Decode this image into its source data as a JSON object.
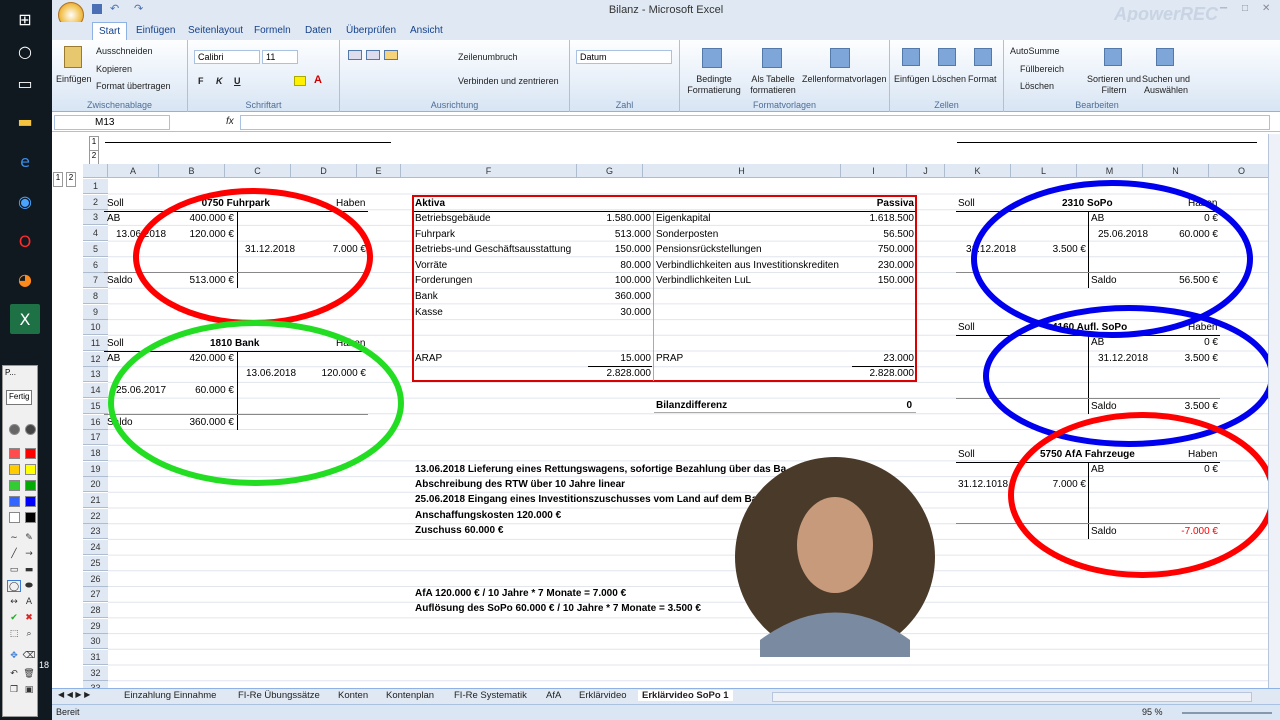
{
  "window": {
    "title": "Bilanz - Microsoft Excel",
    "watermark": "ApowerREC"
  },
  "ribbon": {
    "tabs": [
      "Start",
      "Einfügen",
      "Seitenlayout",
      "Formeln",
      "Daten",
      "Überprüfen",
      "Ansicht"
    ],
    "clipboard": {
      "paste": "Einfügen",
      "cut": "Ausschneiden",
      "copy": "Kopieren",
      "format_painter": "Format übertragen",
      "label": "Zwischenablage"
    },
    "font": {
      "name": "Calibri",
      "size": "11",
      "label": "Schriftart",
      "bold": "F",
      "italic": "K",
      "underline": "U"
    },
    "alignment": {
      "wrap": "Zeilenumbruch",
      "merge": "Verbinden und zentrieren",
      "label": "Ausrichtung"
    },
    "number": {
      "format": "Datum",
      "label": "Zahl"
    },
    "styles": {
      "cond": "Bedingte Formatierung",
      "table": "Als Tabelle formatieren",
      "cell": "Zellenformatvorlagen",
      "label": "Formatvorlagen"
    },
    "cells": {
      "insert": "Einfügen",
      "delete": "Löschen",
      "format": "Format",
      "label": "Zellen"
    },
    "editing": {
      "autosum": "AutoSumme",
      "fill": "Füllbereich",
      "clear": "Löschen",
      "sort": "Sortieren und Filtern",
      "find": "Suchen und Auswählen",
      "label": "Bearbeiten"
    }
  },
  "formula_bar": {
    "name_box": "M13",
    "fx": "fx",
    "value": ""
  },
  "grid": {
    "columns": [
      "A",
      "B",
      "C",
      "D",
      "E",
      "F",
      "G",
      "H",
      "I",
      "J",
      "K",
      "L",
      "M",
      "N",
      "O"
    ],
    "rows": [
      "1",
      "2",
      "3",
      "4",
      "5",
      "6",
      "7",
      "8",
      "9",
      "10",
      "11",
      "12",
      "13",
      "14",
      "15",
      "16",
      "17",
      "18",
      "19",
      "20",
      "21",
      "22",
      "23",
      "24",
      "25",
      "26",
      "27",
      "28",
      "29",
      "30",
      "31",
      "32",
      "33"
    ],
    "outline_levels": [
      "1",
      "2"
    ]
  },
  "fuhrpark": {
    "title": "0750 Fuhrpark",
    "soll": "Soll",
    "haben": "Haben",
    "ab": "AB",
    "ab_val": "400.000 €",
    "d1": "13.06.2018",
    "v1": "120.000 €",
    "d2": "31.12.2018",
    "v2": "7.000 €",
    "saldo": "Saldo",
    "saldo_val": "513.000 €"
  },
  "bank": {
    "title": "1810 Bank",
    "soll": "Soll",
    "haben": "Haben",
    "ab": "AB",
    "ab_val": "420.000 €",
    "d1": "13.06.2018",
    "v1": "120.000 €",
    "d2": "25.06.2017",
    "v2": "60.000 €",
    "saldo": "Saldo",
    "saldo_val": "360.000 €"
  },
  "bilanz": {
    "aktiva": "Aktiva",
    "passiva": "Passiva",
    "left": [
      [
        "Betriebsgebäude",
        "1.580.000"
      ],
      [
        "Fuhrpark",
        "513.000"
      ],
      [
        "Betriebs-und Geschäftsausstattung",
        "150.000"
      ],
      [
        "Vorräte",
        "80.000"
      ],
      [
        "Forderungen",
        "100.000"
      ],
      [
        "Bank",
        "360.000"
      ],
      [
        "Kasse",
        "30.000"
      ]
    ],
    "right": [
      [
        "Eigenkapital",
        "1.618.500"
      ],
      [
        "Sonderposten",
        "56.500"
      ],
      [
        "Pensionsrückstellungen",
        "750.000"
      ],
      [
        "Verbindlichkeiten aus Investitionskrediten",
        "230.000"
      ],
      [
        "Verbindlichkeiten LuL",
        "150.000"
      ]
    ],
    "arap": "ARAP",
    "arap_val": "15.000",
    "prap": "PRAP",
    "prap_val": "23.000",
    "sum_left": "2.828.000",
    "sum_right": "2.828.000",
    "diff_label": "Bilanzdifferenz",
    "diff_val": "0"
  },
  "notes": [
    "13.06.2018 Lieferung eines Rettungswagens, sofortige Bezahlung über das Ba",
    "Abschreibung des RTW über 10 Jahre linear",
    "25.06.2018 Eingang eines Investitionszuschusses vom Land auf dem Ba",
    "Anschaffungskosten 120.000 €",
    "Zuschuss 60.000 €"
  ],
  "calc": [
    "AfA 120.000 € / 10 Jahre * 7 Monate = 7.000 €",
    "Auflösung des SoPo 60.000 € / 10 Jahre * 7 Monate = 3.500 €"
  ],
  "sopo": {
    "title": "2310 SoPo",
    "soll": "Soll",
    "haben": "Haben",
    "ab": "AB",
    "ab_val": "0 €",
    "d1": "25.06.2018",
    "v1": "60.000 €",
    "d2": "31.12.2018",
    "v2": "3.500 €",
    "saldo": "Saldo",
    "saldo_val": "56.500 €"
  },
  "aufl": {
    "title": "4160 Aufl. SoPo",
    "soll": "Soll",
    "haben": "Haben",
    "ab": "AB",
    "ab_val": "0 €",
    "d1": "31.12.2018",
    "v1": "3.500 €",
    "saldo": "Saldo",
    "saldo_val": "3.500 €"
  },
  "afa": {
    "title": "5750 AfA Fahrzeuge",
    "soll": "Soll",
    "haben": "Haben",
    "ab": "AB",
    "ab_val": "0 €",
    "d1": "31.12.1018",
    "v1": "7.000 €",
    "saldo": "Saldo",
    "saldo_val": "-7.000 €"
  },
  "sheet_tabs": [
    "Einzahlung Einnahme",
    "FI-Re Übungssätze",
    "Konten",
    "Kontenplan",
    "FI-Re Systematik",
    "AfA",
    "Erklärvideo",
    "Erklärvideo SoPo 1"
  ],
  "status": {
    "ready": "Bereit",
    "zoom": "95 %"
  },
  "drawpanel": {
    "mode": "Fertig",
    "label": "P...",
    "counter": "18"
  },
  "colors": {
    "red": "#ff0000",
    "green": "#22dd22",
    "blue": "#0000ee",
    "header": "#dfe8f3",
    "negative": "#ff0000"
  }
}
